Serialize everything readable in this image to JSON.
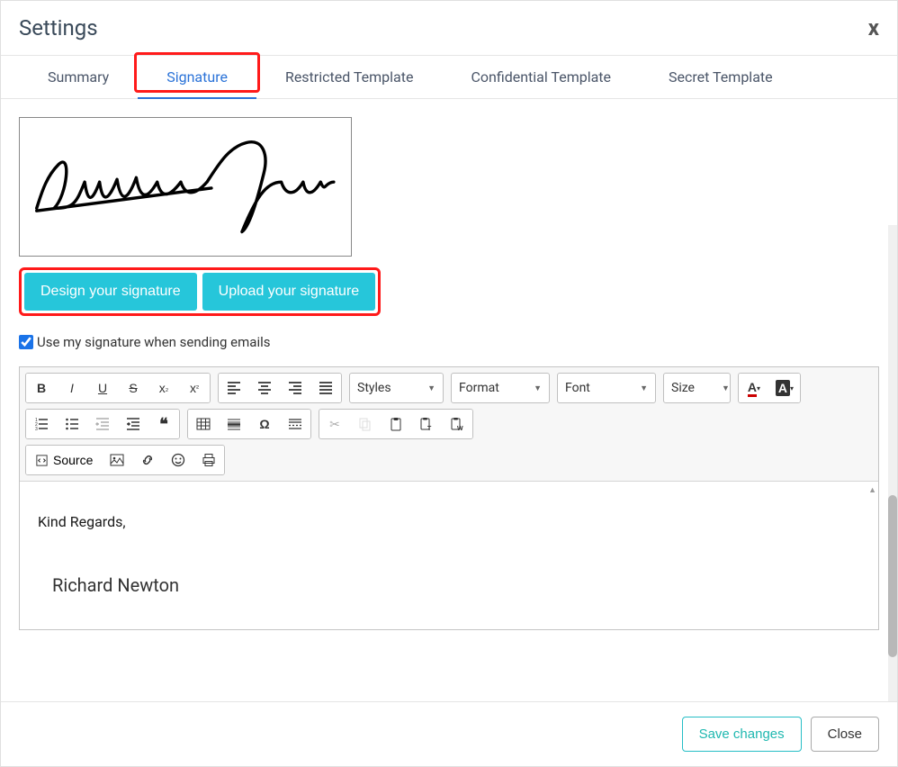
{
  "modal": {
    "title": "Settings",
    "close": "x"
  },
  "tabs": {
    "summary": "Summary",
    "signature": "Signature",
    "restricted": "Restricted Template",
    "confidential": "Confidential Template",
    "secret": "Secret Template"
  },
  "buttons": {
    "design": "Design your signature",
    "upload": "Upload your signature",
    "save": "Save changes",
    "close": "Close"
  },
  "checkbox": {
    "label": "Use my signature when sending emails"
  },
  "toolbar": {
    "styles": "Styles",
    "format": "Format",
    "font": "Font",
    "size": "Size",
    "source": "Source"
  },
  "editor": {
    "greeting": "Kind Regards,",
    "name": "Richard Newton"
  }
}
